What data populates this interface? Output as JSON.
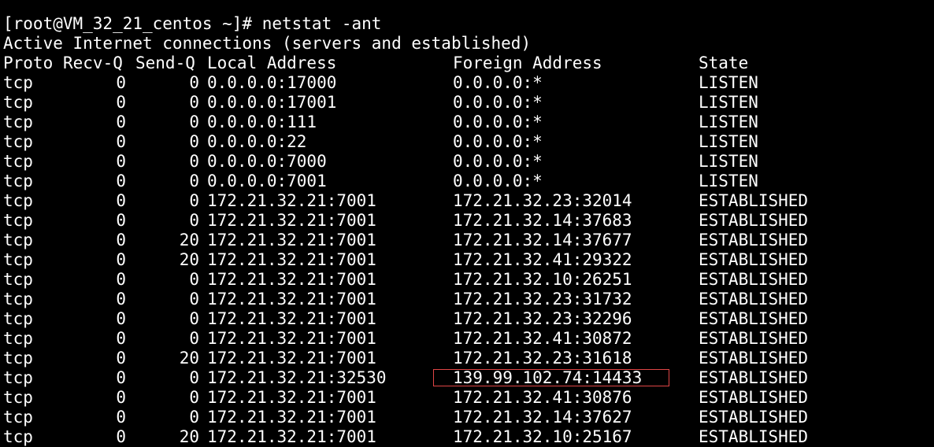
{
  "terminal": {
    "prompt_line": "[root@VM_32_21_centos ~]# netstat -ant",
    "info_line": "Active Internet connections (servers and established)",
    "header": {
      "proto": "Proto",
      "recv": "Recv-Q",
      "send": "Send-Q",
      "local": "Local Address",
      "foreign": "Foreign Address",
      "state": "State"
    },
    "rows": [
      {
        "proto": "tcp",
        "recv": "0",
        "send": "0",
        "local": "0.0.0.0:17000",
        "foreign": "0.0.0.0:*",
        "state": "LISTEN"
      },
      {
        "proto": "tcp",
        "recv": "0",
        "send": "0",
        "local": "0.0.0.0:17001",
        "foreign": "0.0.0.0:*",
        "state": "LISTEN"
      },
      {
        "proto": "tcp",
        "recv": "0",
        "send": "0",
        "local": "0.0.0.0:111",
        "foreign": "0.0.0.0:*",
        "state": "LISTEN"
      },
      {
        "proto": "tcp",
        "recv": "0",
        "send": "0",
        "local": "0.0.0.0:22",
        "foreign": "0.0.0.0:*",
        "state": "LISTEN"
      },
      {
        "proto": "tcp",
        "recv": "0",
        "send": "0",
        "local": "0.0.0.0:7000",
        "foreign": "0.0.0.0:*",
        "state": "LISTEN"
      },
      {
        "proto": "tcp",
        "recv": "0",
        "send": "0",
        "local": "0.0.0.0:7001",
        "foreign": "0.0.0.0:*",
        "state": "LISTEN"
      },
      {
        "proto": "tcp",
        "recv": "0",
        "send": "0",
        "local": "172.21.32.21:7001",
        "foreign": "172.21.32.23:32014",
        "state": "ESTABLISHED"
      },
      {
        "proto": "tcp",
        "recv": "0",
        "send": "0",
        "local": "172.21.32.21:7001",
        "foreign": "172.21.32.14:37683",
        "state": "ESTABLISHED"
      },
      {
        "proto": "tcp",
        "recv": "0",
        "send": "20",
        "local": "172.21.32.21:7001",
        "foreign": "172.21.32.14:37677",
        "state": "ESTABLISHED"
      },
      {
        "proto": "tcp",
        "recv": "0",
        "send": "20",
        "local": "172.21.32.21:7001",
        "foreign": "172.21.32.41:29322",
        "state": "ESTABLISHED"
      },
      {
        "proto": "tcp",
        "recv": "0",
        "send": "0",
        "local": "172.21.32.21:7001",
        "foreign": "172.21.32.10:26251",
        "state": "ESTABLISHED"
      },
      {
        "proto": "tcp",
        "recv": "0",
        "send": "0",
        "local": "172.21.32.21:7001",
        "foreign": "172.21.32.23:31732",
        "state": "ESTABLISHED"
      },
      {
        "proto": "tcp",
        "recv": "0",
        "send": "0",
        "local": "172.21.32.21:7001",
        "foreign": "172.21.32.23:32296",
        "state": "ESTABLISHED"
      },
      {
        "proto": "tcp",
        "recv": "0",
        "send": "0",
        "local": "172.21.32.21:7001",
        "foreign": "172.21.32.41:30872",
        "state": "ESTABLISHED"
      },
      {
        "proto": "tcp",
        "recv": "0",
        "send": "20",
        "local": "172.21.32.21:7001",
        "foreign": "172.21.32.23:31618",
        "state": "ESTABLISHED"
      },
      {
        "proto": "tcp",
        "recv": "0",
        "send": "0",
        "local": "172.21.32.21:32530",
        "foreign": "139.99.102.74:14433",
        "state": "ESTABLISHED"
      },
      {
        "proto": "tcp",
        "recv": "0",
        "send": "0",
        "local": "172.21.32.21:7001",
        "foreign": "172.21.32.41:30876",
        "state": "ESTABLISHED"
      },
      {
        "proto": "tcp",
        "recv": "0",
        "send": "0",
        "local": "172.21.32.21:7001",
        "foreign": "172.21.32.14:37627",
        "state": "ESTABLISHED"
      },
      {
        "proto": "tcp",
        "recv": "0",
        "send": "20",
        "local": "172.21.32.21:7001",
        "foreign": "172.21.32.10:25167",
        "state": "ESTABLISHED"
      }
    ],
    "highlight_color": "#e04646",
    "text_color": "#ffffff",
    "background_color": "#000000"
  }
}
